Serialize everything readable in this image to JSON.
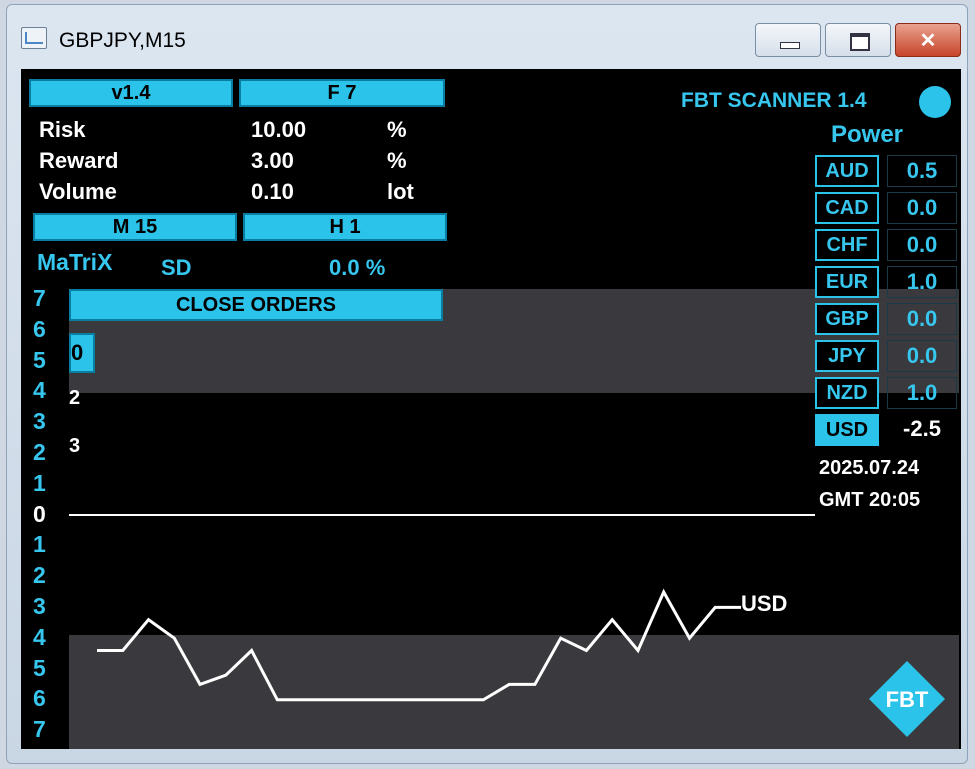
{
  "window": {
    "title": "GBPJPY,M15"
  },
  "panel": {
    "version": "v1.4",
    "f_label": "F 7",
    "risk_label": "Risk",
    "risk_value": "10.00",
    "risk_unit": "%",
    "reward_label": "Reward",
    "reward_value": "3.00",
    "reward_unit": "%",
    "volume_label": "Volume",
    "volume_value": "0.10",
    "volume_unit": "lot",
    "tf1": "M 15",
    "tf2": "H 1",
    "matrix_label": "MaTriX",
    "pair_partial": "SD",
    "pair_pct": "0.0 %",
    "close_orders": "CLOSE  ORDERS",
    "partial_0": "0",
    "partial_2": "2",
    "partial_3": "3"
  },
  "scanner": {
    "title": "FBT SCANNER 1.4",
    "power_label": "Power",
    "currencies": [
      {
        "code": "AUD",
        "value": "0.5"
      },
      {
        "code": "CAD",
        "value": "0.0"
      },
      {
        "code": "CHF",
        "value": "0.0"
      },
      {
        "code": "EUR",
        "value": "1.0"
      },
      {
        "code": "GBP",
        "value": "0.0"
      },
      {
        "code": "JPY",
        "value": "0.0"
      },
      {
        "code": "NZD",
        "value": "1.0"
      },
      {
        "code": "USD",
        "value": "-2.5"
      }
    ],
    "date": "2025.07.24",
    "time": "GMT 20:05"
  },
  "scale": [
    "7",
    "6",
    "5",
    "4",
    "3",
    "2",
    "1",
    "0",
    "1",
    "2",
    "3",
    "4",
    "5",
    "6",
    "7"
  ],
  "chart_data": {
    "type": "line",
    "series": [
      {
        "name": "USD",
        "values": [
          -4.4,
          -4.4,
          -3.4,
          -4.0,
          -5.5,
          -5.2,
          -4.4,
          -6.0,
          -6.0,
          -6.0,
          -6.0,
          -6.0,
          -6.0,
          -6.0,
          -6.0,
          -6.0,
          -5.5,
          -5.5,
          -4.0,
          -4.4,
          -3.4,
          -4.4,
          -2.5,
          -4.0,
          -3.0,
          -3.0
        ]
      }
    ],
    "ylim": [
      -7,
      7
    ]
  },
  "colors": {
    "accent": "#2bc3ea",
    "band": "#3a3a3e",
    "line": "#ffffff"
  },
  "icons": {
    "logo": "fbt-diamond-logo",
    "status": "status-dot-icon"
  }
}
